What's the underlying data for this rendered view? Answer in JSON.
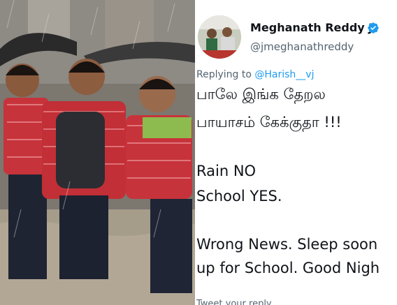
{
  "tweet": {
    "display_name": "Meghanath Reddy J",
    "handle": "@jmeghanathreddy",
    "verified_icon": "verified-badge-icon",
    "replying_prefix": "Replying to ",
    "replying_to": "@Harish__vj",
    "lines": [
      "பாலே இங்க தேறல",
      "பாயாசம் கேக்குதா !!!",
      "Rain NO",
      "School YES.",
      "Wrong News. Sleep soon",
      "up for School. Good Nigh"
    ],
    "compose_placeholder": "Tweet your reply"
  },
  "colors": {
    "accent": "#1d9bf0",
    "text": "#0f1419",
    "muted": "#536471"
  }
}
